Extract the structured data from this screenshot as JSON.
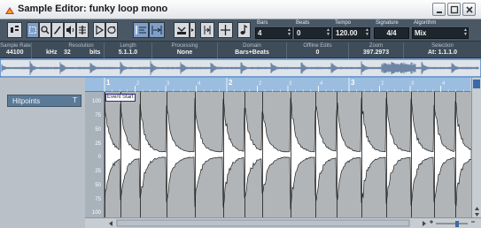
{
  "window": {
    "title": "Sample Editor: funky loop mono"
  },
  "toolbar": {
    "fields": {
      "bars": {
        "label": "Bars",
        "value": "4"
      },
      "beats": {
        "label": "Beats",
        "value": "0"
      },
      "tempo": {
        "label": "Tempo",
        "value": "120.00"
      },
      "signature": {
        "label": "Signature",
        "value": "4/4"
      },
      "algorithm": {
        "label": "Algorithm",
        "value": "Mix"
      }
    }
  },
  "info": {
    "sample_rate": {
      "label": "Sample Rate",
      "value": "44100",
      "unit": "kHz"
    },
    "resolution": {
      "label": "Resolution",
      "value": "32",
      "unit": "bits"
    },
    "length": {
      "label": "Length",
      "value": "5.1.1.0"
    },
    "processing": {
      "label": "Processing",
      "value": "None"
    },
    "domain": {
      "label": "Domain",
      "value": "Bars+Beats"
    },
    "offline_edits": {
      "label": "Offline Edits",
      "value": "0"
    },
    "zoom": {
      "label": "Zoom",
      "value": "397.2973"
    },
    "selection": {
      "label": "Selection",
      "value": "At: 1.1.1.0"
    }
  },
  "left_panel": {
    "hitpoints_label": "Hitpoints",
    "hitpoints_pin": "T"
  },
  "ruler": {
    "bars": [
      "1",
      "2",
      "3"
    ],
    "beats": [
      "2",
      "3",
      "4",
      "2",
      "3",
      "4",
      "2",
      "3",
      "4"
    ]
  },
  "scale": {
    "labels": [
      "100",
      "75",
      "50",
      "25",
      "0",
      "25",
      "50",
      "75",
      "100"
    ]
  },
  "event": {
    "start_label": "Event Start"
  },
  "colors": {
    "toolbar_bg": "#4a5866",
    "info_bg": "#3f4c59",
    "ruler_bg": "#9bbde0",
    "wave_bg": "#b1b5b8",
    "hitpoint_panel": "#5b7a98"
  },
  "icons": [
    "app-icon",
    "minimize-icon",
    "maximize-icon",
    "close-icon",
    "info-toggle-icon",
    "range-selection-icon",
    "zoom-icon",
    "pencil-icon",
    "speaker-icon",
    "scrub-icon",
    "play-icon",
    "loop-icon",
    "hitpoint-edit-icon",
    "warp-icon",
    "snap-icon",
    "grid-icon",
    "metronome-icon"
  ]
}
